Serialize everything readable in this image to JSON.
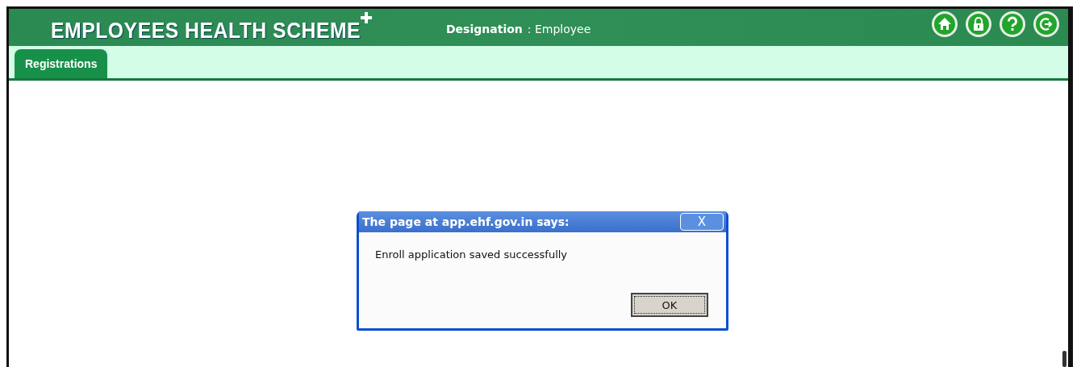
{
  "header": {
    "title": "EMPLOYEES HEALTH SCHEME",
    "designation_label": "Designation",
    "designation_value": ": Employee",
    "icons": [
      {
        "kind": "home"
      },
      {
        "kind": "lock"
      },
      {
        "kind": "help"
      },
      {
        "kind": "logout"
      }
    ]
  },
  "tabs": [
    {
      "label": "Registrations",
      "selected": true
    }
  ],
  "dialog": {
    "title": "The page at app.ehf.gov.in says:",
    "close": "X",
    "message": "Enroll application saved successfully",
    "button": "OK"
  }
}
